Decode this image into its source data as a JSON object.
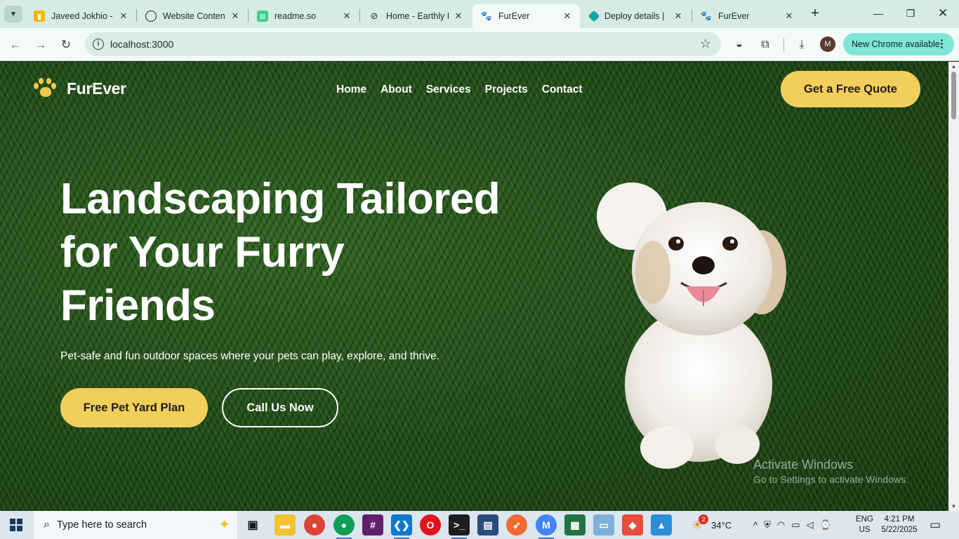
{
  "browser": {
    "tabs": [
      {
        "title": "Javeed Jokhio - G",
        "icon": "google-slides-icon",
        "color": "#f4b400",
        "active": false
      },
      {
        "title": "Website Content",
        "icon": "openai-icon",
        "color": "#1f1f1f",
        "active": false
      },
      {
        "title": "readme.so",
        "icon": "readme-icon",
        "color": "#3ecf8e",
        "active": false
      },
      {
        "title": "Home - Earthly D",
        "icon": "earth-icon",
        "color": "#1f1f1f",
        "active": false
      },
      {
        "title": "FurEver",
        "icon": "paw-icon",
        "color": "#1f1f1f",
        "active": true
      },
      {
        "title": "Deploy details |",
        "icon": "netlify-icon",
        "color": "#16a5a5",
        "active": false
      },
      {
        "title": "FurEver",
        "icon": "paw-icon",
        "color": "#1f1f1f",
        "active": false
      }
    ],
    "url": "localhost:3000",
    "profile_initial": "M",
    "update_label": "New Chrome available"
  },
  "site": {
    "brand": "FurEver",
    "nav": [
      "Home",
      "About",
      "Services",
      "Projects",
      "Contact"
    ],
    "quote_button": "Get a Free Quote",
    "hero": {
      "title_line1": "Landscaping Tailored",
      "title_line2": "for Your Furry",
      "title_line3": "Friends",
      "subtitle": "Pet-safe and fun outdoor spaces where your pets can play, explore, and thrive.",
      "primary_button": "Free Pet Yard Plan",
      "secondary_button": "Call Us Now"
    },
    "accent_color": "#f2cf5b"
  },
  "watermark": {
    "line1": "Activate Windows",
    "line2": "Go to Settings to activate Windows."
  },
  "taskbar": {
    "search_placeholder": "Type here to search",
    "weather_badge": "2",
    "temperature": "34°C",
    "language": "ENG",
    "region": "US",
    "time": "4:21 PM",
    "date": "5/22/2025"
  }
}
